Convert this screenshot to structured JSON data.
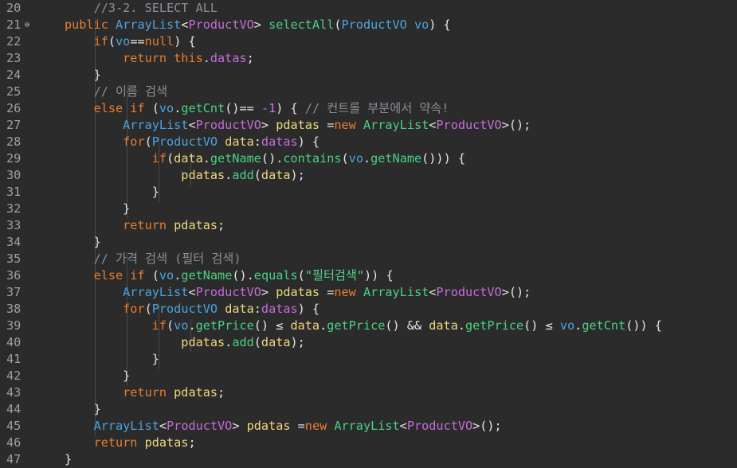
{
  "editor": {
    "lines": [
      {
        "num": "20",
        "fold": false,
        "tokens": [
          {
            "t": "    //3-2. SELECT ALL",
            "c": "cm"
          }
        ]
      },
      {
        "num": "21",
        "fold": true,
        "tokens": [
          {
            "t": "public ",
            "c": "kw"
          },
          {
            "t": "ArrayList",
            "c": "ty"
          },
          {
            "t": "<",
            "c": "op"
          },
          {
            "t": "ProductVO",
            "c": "gn"
          },
          {
            "t": "> ",
            "c": "op"
          },
          {
            "t": "selectAll",
            "c": "fn"
          },
          {
            "t": "(",
            "c": "op"
          },
          {
            "t": "ProductVO ",
            "c": "ty"
          },
          {
            "t": "vo",
            "c": "pr"
          },
          {
            "t": ") {",
            "c": "op"
          }
        ]
      },
      {
        "num": "22",
        "fold": false,
        "tokens": [
          {
            "t": "    if",
            "c": "kw"
          },
          {
            "t": "(",
            "c": "op"
          },
          {
            "t": "vo",
            "c": "pr"
          },
          {
            "t": "==",
            "c": "op"
          },
          {
            "t": "null",
            "c": "kw"
          },
          {
            "t": ") {",
            "c": "op"
          }
        ]
      },
      {
        "num": "23",
        "fold": false,
        "tokens": [
          {
            "t": "        return ",
            "c": "kw"
          },
          {
            "t": "this",
            "c": "kw"
          },
          {
            "t": ".",
            "c": "op"
          },
          {
            "t": "datas",
            "c": "fd"
          },
          {
            "t": ";",
            "c": "op"
          }
        ]
      },
      {
        "num": "24",
        "fold": false,
        "tokens": [
          {
            "t": "    }",
            "c": "op"
          }
        ]
      },
      {
        "num": "25",
        "fold": false,
        "tokens": [
          {
            "t": "    // 이름 검색",
            "c": "cm"
          }
        ]
      },
      {
        "num": "26",
        "fold": false,
        "tokens": [
          {
            "t": "    else if ",
            "c": "kw"
          },
          {
            "t": "(",
            "c": "op"
          },
          {
            "t": "vo",
            "c": "pr"
          },
          {
            "t": ".",
            "c": "op"
          },
          {
            "t": "getCnt",
            "c": "fn"
          },
          {
            "t": "()== ",
            "c": "op"
          },
          {
            "t": "-1",
            "c": "nm"
          },
          {
            "t": ") { ",
            "c": "op"
          },
          {
            "t": "// 컨트롤 부분에서 약속!",
            "c": "cm"
          }
        ]
      },
      {
        "num": "27",
        "fold": false,
        "tokens": [
          {
            "t": "        ArrayList",
            "c": "ty"
          },
          {
            "t": "<",
            "c": "op"
          },
          {
            "t": "ProductVO",
            "c": "gn"
          },
          {
            "t": "> ",
            "c": "op"
          },
          {
            "t": "pdatas ",
            "c": "id"
          },
          {
            "t": "=",
            "c": "op"
          },
          {
            "t": "new ",
            "c": "kw"
          },
          {
            "t": "ArrayList",
            "c": "fn"
          },
          {
            "t": "<",
            "c": "op"
          },
          {
            "t": "ProductVO",
            "c": "gn"
          },
          {
            "t": ">();",
            "c": "op"
          }
        ]
      },
      {
        "num": "28",
        "fold": false,
        "tokens": [
          {
            "t": "        for",
            "c": "kw"
          },
          {
            "t": "(",
            "c": "op"
          },
          {
            "t": "ProductVO ",
            "c": "ty"
          },
          {
            "t": "data",
            "c": "id"
          },
          {
            "t": ":",
            "c": "op"
          },
          {
            "t": "datas",
            "c": "fd"
          },
          {
            "t": ") {",
            "c": "op"
          }
        ]
      },
      {
        "num": "29",
        "fold": false,
        "tokens": [
          {
            "t": "            if",
            "c": "kw"
          },
          {
            "t": "(",
            "c": "op"
          },
          {
            "t": "data",
            "c": "id"
          },
          {
            "t": ".",
            "c": "op"
          },
          {
            "t": "getName",
            "c": "fn"
          },
          {
            "t": "().",
            "c": "op"
          },
          {
            "t": "contains",
            "c": "fn"
          },
          {
            "t": "(",
            "c": "op"
          },
          {
            "t": "vo",
            "c": "pr"
          },
          {
            "t": ".",
            "c": "op"
          },
          {
            "t": "getName",
            "c": "fn"
          },
          {
            "t": "())) {",
            "c": "op"
          }
        ]
      },
      {
        "num": "30",
        "fold": false,
        "tokens": [
          {
            "t": "                pdatas",
            "c": "id"
          },
          {
            "t": ".",
            "c": "op"
          },
          {
            "t": "add",
            "c": "fn"
          },
          {
            "t": "(",
            "c": "op"
          },
          {
            "t": "data",
            "c": "id"
          },
          {
            "t": ");",
            "c": "op"
          }
        ]
      },
      {
        "num": "31",
        "fold": false,
        "tokens": [
          {
            "t": "            }",
            "c": "op"
          }
        ]
      },
      {
        "num": "32",
        "fold": false,
        "tokens": [
          {
            "t": "        }",
            "c": "op"
          }
        ]
      },
      {
        "num": "33",
        "fold": false,
        "tokens": [
          {
            "t": "        return ",
            "c": "kw"
          },
          {
            "t": "pdatas",
            "c": "id"
          },
          {
            "t": ";",
            "c": "op"
          }
        ]
      },
      {
        "num": "34",
        "fold": false,
        "tokens": [
          {
            "t": "    }",
            "c": "op"
          }
        ]
      },
      {
        "num": "35",
        "fold": false,
        "tokens": [
          {
            "t": "    // 가격 검색 (필터 검색)",
            "c": "cm"
          }
        ]
      },
      {
        "num": "36",
        "fold": false,
        "tokens": [
          {
            "t": "    else if ",
            "c": "kw"
          },
          {
            "t": "(",
            "c": "op"
          },
          {
            "t": "vo",
            "c": "pr"
          },
          {
            "t": ".",
            "c": "op"
          },
          {
            "t": "getName",
            "c": "fn"
          },
          {
            "t": "().",
            "c": "op"
          },
          {
            "t": "equals",
            "c": "fn"
          },
          {
            "t": "(",
            "c": "op"
          },
          {
            "t": "\"필터검색\"",
            "c": "st"
          },
          {
            "t": ")) {",
            "c": "op"
          }
        ]
      },
      {
        "num": "37",
        "fold": false,
        "tokens": [
          {
            "t": "        ArrayList",
            "c": "ty"
          },
          {
            "t": "<",
            "c": "op"
          },
          {
            "t": "ProductVO",
            "c": "gn"
          },
          {
            "t": "> ",
            "c": "op"
          },
          {
            "t": "pdatas ",
            "c": "id"
          },
          {
            "t": "=",
            "c": "op"
          },
          {
            "t": "new ",
            "c": "kw"
          },
          {
            "t": "ArrayList",
            "c": "fn"
          },
          {
            "t": "<",
            "c": "op"
          },
          {
            "t": "ProductVO",
            "c": "gn"
          },
          {
            "t": ">();",
            "c": "op"
          }
        ]
      },
      {
        "num": "38",
        "fold": false,
        "tokens": [
          {
            "t": "        for",
            "c": "kw"
          },
          {
            "t": "(",
            "c": "op"
          },
          {
            "t": "ProductVO ",
            "c": "ty"
          },
          {
            "t": "data",
            "c": "id"
          },
          {
            "t": ":",
            "c": "op"
          },
          {
            "t": "datas",
            "c": "fd"
          },
          {
            "t": ") {",
            "c": "op"
          }
        ]
      },
      {
        "num": "39",
        "fold": false,
        "tokens": [
          {
            "t": "            if",
            "c": "kw"
          },
          {
            "t": "(",
            "c": "op"
          },
          {
            "t": "vo",
            "c": "pr"
          },
          {
            "t": ".",
            "c": "op"
          },
          {
            "t": "getPrice",
            "c": "fn"
          },
          {
            "t": "() ≤ ",
            "c": "op"
          },
          {
            "t": "data",
            "c": "id"
          },
          {
            "t": ".",
            "c": "op"
          },
          {
            "t": "getPrice",
            "c": "fn"
          },
          {
            "t": "() && ",
            "c": "op"
          },
          {
            "t": "data",
            "c": "id"
          },
          {
            "t": ".",
            "c": "op"
          },
          {
            "t": "getPrice",
            "c": "fn"
          },
          {
            "t": "() ≤ ",
            "c": "op"
          },
          {
            "t": "vo",
            "c": "pr"
          },
          {
            "t": ".",
            "c": "op"
          },
          {
            "t": "getCnt",
            "c": "fn"
          },
          {
            "t": "()) {",
            "c": "op"
          }
        ]
      },
      {
        "num": "40",
        "fold": false,
        "tokens": [
          {
            "t": "                pdatas",
            "c": "id"
          },
          {
            "t": ".",
            "c": "op"
          },
          {
            "t": "add",
            "c": "fn"
          },
          {
            "t": "(",
            "c": "op"
          },
          {
            "t": "data",
            "c": "id"
          },
          {
            "t": ");",
            "c": "op"
          }
        ]
      },
      {
        "num": "41",
        "fold": false,
        "tokens": [
          {
            "t": "            }",
            "c": "op"
          }
        ]
      },
      {
        "num": "42",
        "fold": false,
        "tokens": [
          {
            "t": "        }",
            "c": "op"
          }
        ]
      },
      {
        "num": "43",
        "fold": false,
        "tokens": [
          {
            "t": "        return ",
            "c": "kw"
          },
          {
            "t": "pdatas",
            "c": "id"
          },
          {
            "t": ";",
            "c": "op"
          }
        ]
      },
      {
        "num": "44",
        "fold": false,
        "tokens": [
          {
            "t": "    }",
            "c": "op"
          }
        ]
      },
      {
        "num": "45",
        "fold": false,
        "tokens": [
          {
            "t": "    ArrayList",
            "c": "ty"
          },
          {
            "t": "<",
            "c": "op"
          },
          {
            "t": "ProductVO",
            "c": "gn"
          },
          {
            "t": "> ",
            "c": "op"
          },
          {
            "t": "pdatas ",
            "c": "id"
          },
          {
            "t": "=",
            "c": "op"
          },
          {
            "t": "new ",
            "c": "kw"
          },
          {
            "t": "ArrayList",
            "c": "fn"
          },
          {
            "t": "<",
            "c": "op"
          },
          {
            "t": "ProductVO",
            "c": "gn"
          },
          {
            "t": ">();",
            "c": "op"
          }
        ]
      },
      {
        "num": "46",
        "fold": false,
        "tokens": [
          {
            "t": "    return ",
            "c": "kw"
          },
          {
            "t": "pdatas",
            "c": "id"
          },
          {
            "t": ";",
            "c": "op"
          }
        ]
      },
      {
        "num": "47",
        "fold": false,
        "tokens": [
          {
            "t": "}",
            "c": "op"
          }
        ]
      }
    ]
  }
}
